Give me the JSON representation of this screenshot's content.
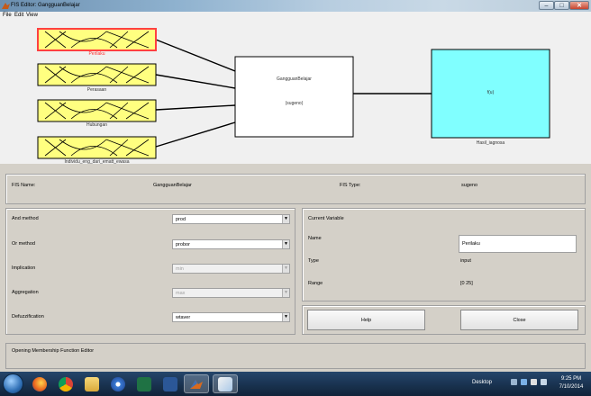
{
  "window": {
    "title": "FIS Editor: GangguanBelajar",
    "controls": {
      "minimize": "–",
      "maximize": "□",
      "close": "✕"
    }
  },
  "menu": {
    "items": [
      "File",
      "Edit",
      "View"
    ]
  },
  "diagram": {
    "inputs": [
      "Perilaku",
      "Perasaan",
      "Hubungan",
      "Individu_eng_dari_ematt_ewasa"
    ],
    "selected_input": "Perilaku",
    "system_name": "GangguanBelajar",
    "system_type": "(sugeno)",
    "output_box_label": "f(u)",
    "output_name": "Hasil_iagnosa",
    "colors": {
      "input_fill": "#ffff80",
      "selected_border": "#ff4040",
      "output_fill": "#80ffff"
    }
  },
  "fis": {
    "name_label": "FIS Name:",
    "name_value": "GangguanBelajar",
    "type_label": "FIS Type:",
    "type_value": "sugeno"
  },
  "methods": {
    "and": {
      "label": "And method",
      "value": "prod"
    },
    "or": {
      "label": "Or method",
      "value": "probor"
    },
    "implication": {
      "label": "Implication",
      "value": "min"
    },
    "aggregation": {
      "label": "Aggregation",
      "value": "max"
    },
    "defuzzification": {
      "label": "Defuzzification",
      "value": "wtaver"
    }
  },
  "current_variable": {
    "heading": "Current Variable",
    "name_label": "Name",
    "name_value": "Perilaku",
    "type_label": "Type",
    "type_value": "input",
    "range_label": "Range",
    "range_value": "[0 25]"
  },
  "buttons": {
    "help": "Help",
    "close": "Close"
  },
  "status": {
    "text": "Opening Membership Function Editor"
  },
  "taskbar": {
    "desktop_label": "Desktop",
    "time": "9:25 PM",
    "date": "7/10/2014",
    "apps": [
      "firefox-icon",
      "chrome-icon",
      "file-explorer-icon",
      "media-player-icon",
      "excel-icon",
      "word-icon",
      "matlab-icon",
      "paint-icon"
    ]
  }
}
